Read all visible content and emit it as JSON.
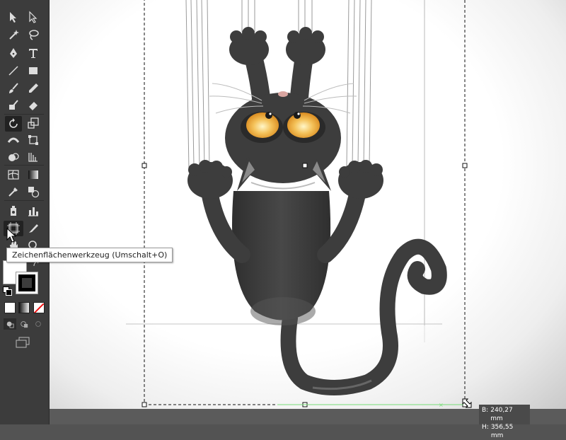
{
  "toolbar": {
    "tools": [
      {
        "name": "selection-tool",
        "icon": "arrow-icon"
      },
      {
        "name": "direct-selection-tool",
        "icon": "white-arrow-icon"
      },
      {
        "name": "magic-wand-tool",
        "icon": "magic-wand-icon"
      },
      {
        "name": "lasso-tool",
        "icon": "lasso-icon"
      },
      {
        "name": "pen-tool",
        "icon": "pen-icon"
      },
      {
        "name": "type-tool",
        "icon": "type-icon"
      },
      {
        "name": "line-tool",
        "icon": "line-icon"
      },
      {
        "name": "rectangle-tool",
        "icon": "rectangle-icon"
      },
      {
        "name": "paintbrush-tool",
        "icon": "brush-icon"
      },
      {
        "name": "pencil-tool",
        "icon": "pencil-icon"
      },
      {
        "name": "blob-brush-tool",
        "icon": "blob-brush-icon"
      },
      {
        "name": "eraser-tool",
        "icon": "eraser-icon"
      },
      {
        "name": "rotate-tool",
        "icon": "rotate-icon"
      },
      {
        "name": "scale-tool",
        "icon": "scale-icon"
      },
      {
        "name": "width-tool",
        "icon": "width-icon"
      },
      {
        "name": "free-transform-tool",
        "icon": "free-transform-icon"
      },
      {
        "name": "shape-builder-tool",
        "icon": "shape-builder-icon"
      },
      {
        "name": "perspective-grid-tool",
        "icon": "perspective-grid-icon"
      },
      {
        "name": "mesh-tool",
        "icon": "mesh-icon"
      },
      {
        "name": "gradient-tool",
        "icon": "gradient-icon"
      },
      {
        "name": "eyedropper-tool",
        "icon": "eyedropper-icon"
      },
      {
        "name": "blend-tool",
        "icon": "blend-icon"
      },
      {
        "name": "symbol-sprayer-tool",
        "icon": "symbol-sprayer-icon"
      },
      {
        "name": "column-graph-tool",
        "icon": "column-graph-icon"
      },
      {
        "name": "artboard-tool",
        "icon": "artboard-icon"
      },
      {
        "name": "slice-tool",
        "icon": "slice-icon"
      },
      {
        "name": "hand-tool",
        "icon": "hand-icon"
      },
      {
        "name": "zoom-tool",
        "icon": "zoom-icon"
      }
    ],
    "fill_color": "#ffffff",
    "stroke_color": "#000000"
  },
  "tooltip": {
    "text": "Zeichenflächenwerkzeug (Umschalt+O)"
  },
  "readout": {
    "width_label": "B:",
    "width_value": "240,27 mm",
    "height_label": "H:",
    "height_value": "356,55 mm"
  },
  "colors": {
    "toolbar_bg": "#3c3c3c",
    "cat_body": "#3d3d3d",
    "eye": "#f4c25a",
    "guide": "#77dd77"
  }
}
